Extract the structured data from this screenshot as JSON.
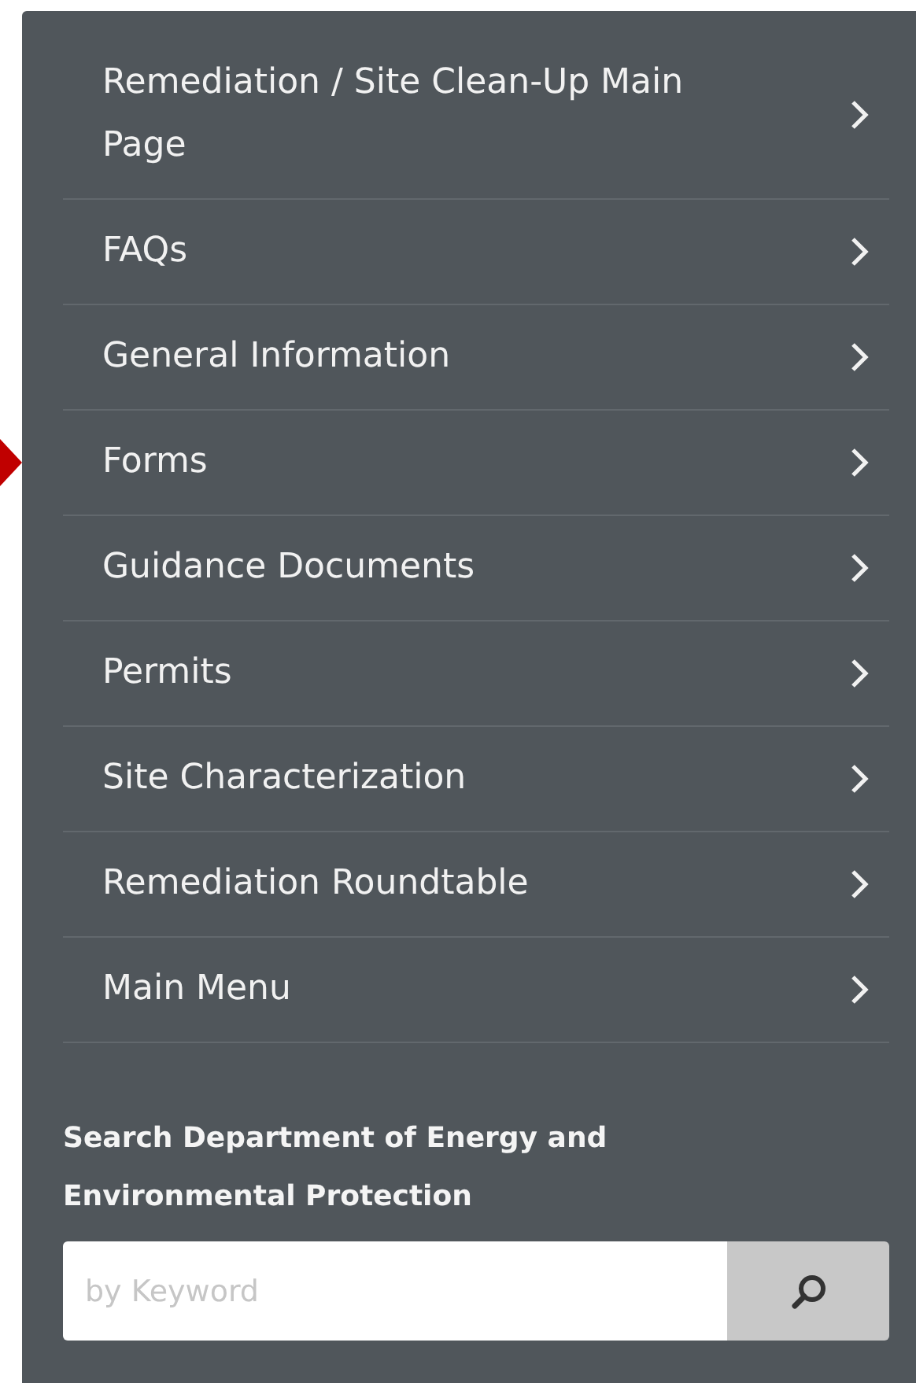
{
  "menu": {
    "items": [
      {
        "label": "Remediation / Site Clean-Up Main Page",
        "pointed": false
      },
      {
        "label": "FAQs",
        "pointed": false
      },
      {
        "label": "General Information",
        "pointed": false
      },
      {
        "label": "Forms",
        "pointed": true
      },
      {
        "label": "Guidance Documents",
        "pointed": false
      },
      {
        "label": "Permits",
        "pointed": false
      },
      {
        "label": "Site Characterization",
        "pointed": false
      },
      {
        "label": "Remediation Roundtable",
        "pointed": false
      },
      {
        "label": "Main Menu",
        "pointed": false
      }
    ]
  },
  "search": {
    "heading": "Search Department of Energy and Environmental Protection",
    "placeholder": "by Keyword"
  }
}
